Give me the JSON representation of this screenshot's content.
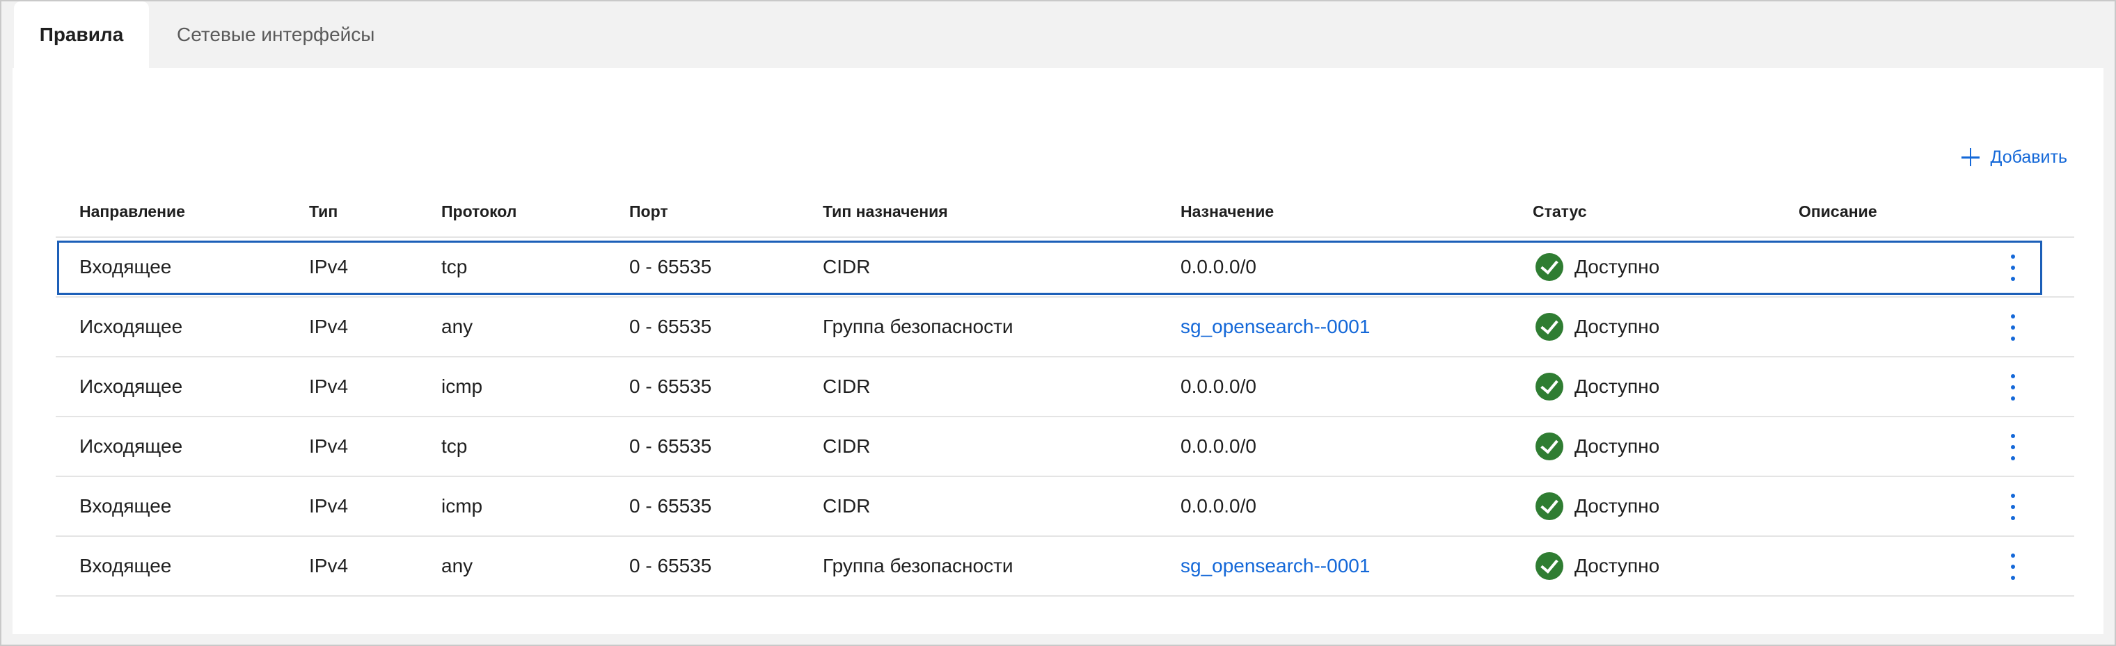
{
  "tabs": [
    {
      "label": "Правила",
      "active": true
    },
    {
      "label": "Сетевые интерфейсы",
      "active": false
    }
  ],
  "toolbar": {
    "add_label": "Добавить",
    "add_icon": "plus-icon"
  },
  "table": {
    "columns": [
      "Направление",
      "Тип",
      "Протокол",
      "Порт",
      "Тип назначения",
      "Назначение",
      "Статус",
      "Описание"
    ],
    "rows": [
      {
        "direction": "Входящее",
        "type": "IPv4",
        "protocol": "tcp",
        "port": "0 - 65535",
        "dest_type": "CIDR",
        "destination": "0.0.0.0/0",
        "status": "Доступно",
        "description": ""
      },
      {
        "direction": "Исходящее",
        "type": "IPv4",
        "protocol": "any",
        "port": "0 - 65535",
        "dest_type": "Группа безопасности",
        "destination": "sg_opensearch--0001",
        "status": "Доступно",
        "description": ""
      },
      {
        "direction": "Исходящее",
        "type": "IPv4",
        "protocol": "icmp",
        "port": "0 - 65535",
        "dest_type": "CIDR",
        "destination": "0.0.0.0/0",
        "status": "Доступно",
        "description": ""
      },
      {
        "direction": "Исходящее",
        "type": "IPv4",
        "protocol": "tcp",
        "port": "0 - 65535",
        "dest_type": "CIDR",
        "destination": "0.0.0.0/0",
        "status": "Доступно",
        "description": ""
      },
      {
        "direction": "Входящее",
        "type": "IPv4",
        "protocol": "icmp",
        "port": "0 - 65535",
        "dest_type": "CIDR",
        "destination": "0.0.0.0/0",
        "status": "Доступно",
        "description": ""
      },
      {
        "direction": "Входящее",
        "type": "IPv4",
        "protocol": "any",
        "port": "0 - 65535",
        "dest_type": "Группа безопасности",
        "destination": "sg_opensearch--0001",
        "status": "Доступно",
        "description": ""
      }
    ]
  },
  "colors": {
    "accent": "#1468d8",
    "status_ok": "#2f7d32",
    "selection_border": "#1c5fb8"
  }
}
